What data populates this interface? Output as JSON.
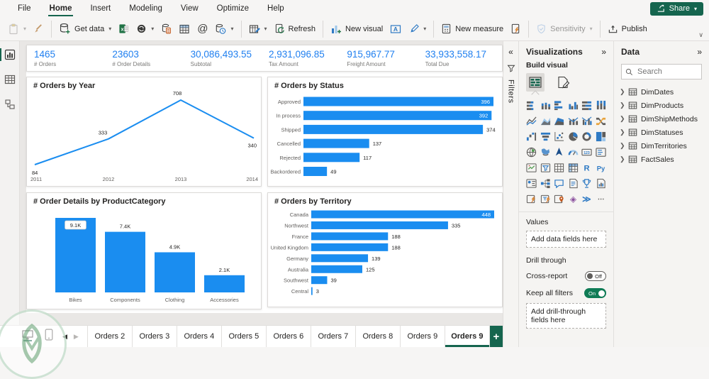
{
  "colors": {
    "accent_blue": "#1a8df0",
    "brand_green": "#15654e",
    "toggle_on_green": "#0f7b55",
    "kpi_value_blue": "#2180f0"
  },
  "window": {
    "menu_items": [
      "File",
      "Home",
      "Insert",
      "Modeling",
      "View",
      "Optimize",
      "Help"
    ],
    "active_menu": "Home",
    "share_label": "Share"
  },
  "ribbon": {
    "labels": {
      "get_data": "Get data",
      "refresh": "Refresh",
      "new_visual": "New visual",
      "new_measure": "New measure",
      "sensitivity": "Sensitivity",
      "publish": "Publish"
    },
    "icons": [
      "paste-icon",
      "format-painter-icon",
      "get-data-icon",
      "excel-workbook-icon",
      "semantic-model-icon",
      "sql-server-icon",
      "enter-data-icon",
      "dataverse-icon",
      "recent-sources-icon",
      "transform-data-icon",
      "refresh-icon",
      "new-visual-icon",
      "text-box-icon",
      "shapes-icon",
      "new-measure-icon",
      "quick-measure-icon",
      "sensitivity-icon",
      "publish-icon",
      "share-icon",
      "ribbon-collapse-icon"
    ]
  },
  "left_rail": {
    "icons": [
      "report-view-icon",
      "table-view-icon",
      "model-view-icon"
    ],
    "active": "report-view-icon"
  },
  "kpis": [
    {
      "value": "1465",
      "label": "# Orders"
    },
    {
      "value": "23603",
      "label": "# Order Details"
    },
    {
      "value": "30,086,493.55",
      "label": "Subtotal"
    },
    {
      "value": "2,931,096.85",
      "label": "Tax Amount"
    },
    {
      "value": "915,967.77",
      "label": "Freight Amount"
    },
    {
      "value": "33,933,558.17",
      "label": "Total Due"
    }
  ],
  "chart_data": [
    {
      "type": "line",
      "title": "# Orders by Year",
      "x": [
        "2011",
        "2012",
        "2013",
        "2014"
      ],
      "values": [
        84,
        333,
        708,
        340
      ],
      "series_color": "#1a8df0",
      "data_labels": true
    },
    {
      "type": "bar",
      "title": "# Orders by Status",
      "categories": [
        "Approved",
        "In process",
        "Shipped",
        "Cancelled",
        "Rejected",
        "Backordered"
      ],
      "values": [
        396,
        392,
        374,
        137,
        117,
        49
      ],
      "series_color": "#1a8df0",
      "data_labels": true
    },
    {
      "type": "column",
      "title": "# Order Details by ProductCategory",
      "categories": [
        "Bikes",
        "Components",
        "Clothing",
        "Accessories"
      ],
      "values": [
        9100,
        7400,
        4900,
        2100
      ],
      "value_labels": [
        "9.1K",
        "7.4K",
        "4.9K",
        "2.1K"
      ],
      "series_color": "#1a8df0",
      "data_labels": true
    },
    {
      "type": "bar",
      "title": "# Orders by Territory",
      "categories": [
        "Canada",
        "Northwest",
        "France",
        "United Kingdom",
        "Germany",
        "Australia",
        "Southwest",
        "Central"
      ],
      "values": [
        448,
        335,
        188,
        188,
        139,
        125,
        39,
        3
      ],
      "series_color": "#1a8df0",
      "data_labels": true
    }
  ],
  "filters_pane": {
    "collapsed_label": "Filters",
    "expand_icon": "double-chevron-left-icon",
    "filter_icon": "filter-funnel-icon"
  },
  "viz_pane": {
    "title": "Visualizations",
    "collapse_icon": "double-chevron-right-icon",
    "build_visual_label": "Build visual",
    "mode_icons": [
      "build-visual-icon",
      "format-visual-icon"
    ],
    "visual_icons": [
      "stacked-bar-chart",
      "stacked-column-chart",
      "clustered-bar-chart",
      "clustered-column-chart",
      "100-stacked-bar-chart",
      "100-stacked-column-chart",
      "line-chart",
      "area-chart",
      "stacked-area-chart",
      "line-and-stacked-column-chart",
      "line-and-clustered-column-chart",
      "ribbon-chart",
      "waterfall-chart",
      "funnel-chart",
      "scatter-chart",
      "pie-chart",
      "donut-chart",
      "treemap",
      "map",
      "filled-map",
      "azure-map",
      "gauge",
      "card",
      "multi-row-card",
      "kpi",
      "slicer",
      "table",
      "matrix",
      "r-script-visual",
      "python-visual",
      "key-influencers",
      "decomposition-tree",
      "qa-visual",
      "smart-narrative",
      "metrics",
      "paginated-report",
      "power-apps-visual",
      "power-automate-visual",
      "arcgis-map",
      "custom-visual-diamond",
      "custom-visual-flow",
      "more-options"
    ],
    "values_label": "Values",
    "add_data_fields": "Add data fields here",
    "drill_through_label": "Drill through",
    "cross_report_label": "Cross-report",
    "cross_report_state": "Off",
    "keep_all_filters_label": "Keep all filters",
    "keep_all_filters_state": "On",
    "add_drill_fields": "Add drill-through fields here"
  },
  "data_pane": {
    "title": "Data",
    "collapse_icon": "double-chevron-right-icon",
    "search_placeholder": "Search",
    "tables": [
      "DimDates",
      "DimProducts",
      "DimShipMethods",
      "DimStatuses",
      "DimTerritories",
      "FactSales"
    ]
  },
  "bottom_bar": {
    "view_icons": [
      "desktop-view-icon",
      "mobile-view-icon"
    ],
    "active_view": "desktop-view-icon",
    "prev_page_icon": "page-prev-icon",
    "next_page_icon": "page-next-icon",
    "tabs": [
      {
        "label": "Orders 2",
        "active": false
      },
      {
        "label": "Orders 3",
        "active": false
      },
      {
        "label": "Orders 4",
        "active": false
      },
      {
        "label": "Orders 5",
        "active": false
      },
      {
        "label": "Orders 6",
        "active": false
      },
      {
        "label": "Orders 7",
        "active": false
      },
      {
        "label": "Orders 8",
        "active": false
      },
      {
        "label": "Orders 9",
        "active": false
      },
      {
        "label": "Orders 9",
        "active": true
      }
    ],
    "add_page_label": "+"
  }
}
